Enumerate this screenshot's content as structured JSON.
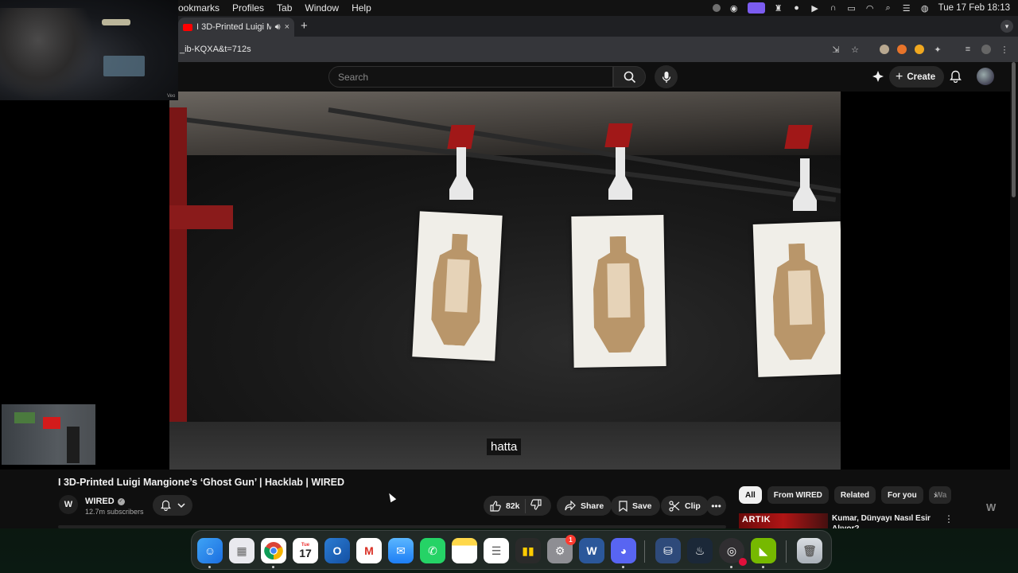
{
  "menubar": {
    "menus": [
      "ookmarks",
      "Profiles",
      "Tab",
      "Window",
      "Help"
    ],
    "clock": "Tue 17 Feb  18:13"
  },
  "browser": {
    "tab_title": "I 3D-Printed Luigi Mangio",
    "tab_close": "×",
    "new_tab": "+",
    "url": "_ib-KQXA&t=712s"
  },
  "youtube": {
    "search_placeholder": "Search",
    "create_label": "Create",
    "webcam_label": "Veo",
    "caption": "hatta",
    "video_title": "I 3D-Printed Luigi Mangione’s ‘Ghost Gun’ | Hacklab | WIRED",
    "channel": {
      "name": "WIRED",
      "subscribers": "12.7m subscribers",
      "avatar_text": "W"
    },
    "actions": {
      "likes": "82k",
      "share": "Share",
      "save": "Save",
      "clip": "Clip"
    },
    "chips": [
      "All",
      "From WIRED",
      "Related",
      "For you",
      "Wa"
    ],
    "recommended": {
      "thumb_text": "ARTIK",
      "title": "Kumar, Dünyayı Nasıl Esir Alıyor?"
    }
  },
  "dock": {
    "calendar_month": "Tue",
    "calendar_day": "17",
    "mail_badge": "1"
  },
  "colors": {
    "yt_bg": "#0f0f0f",
    "chip_bg": "#272727",
    "accent_red": "#ff0000"
  }
}
